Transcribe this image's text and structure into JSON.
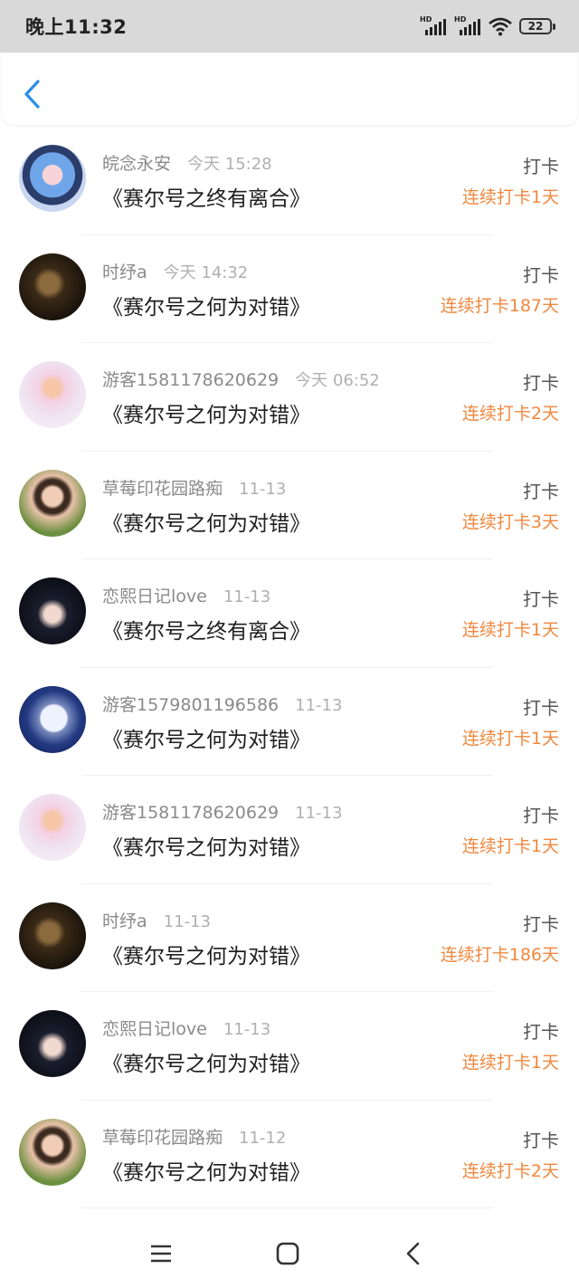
{
  "status": {
    "time": "晚上11:32",
    "signal1": "HD",
    "signal2": "HD",
    "battery": "22"
  },
  "nav": {
    "back_icon": "chevron-left-icon"
  },
  "colors": {
    "accent": "#2a8ee8",
    "streak": "#f0883f"
  },
  "items": [
    {
      "name": "皖念永安",
      "time": "今天 15:28",
      "title": "《赛尔号之终有离合》",
      "tag": "打卡",
      "streak": "连续打卡1天",
      "avatar": "anime-girl-blue"
    },
    {
      "name": "时纾a",
      "time": "今天 14:32",
      "title": "《赛尔号之何为对错》",
      "tag": "打卡",
      "streak": "连续打卡187天",
      "avatar": "dark-photo"
    },
    {
      "name": "游客1581178620629",
      "time": "今天 06:52",
      "title": "《赛尔号之何为对错》",
      "tag": "打卡",
      "streak": "连续打卡2天",
      "avatar": "pink-anime"
    },
    {
      "name": "草莓印花园路痴",
      "time": "11-13",
      "title": "《赛尔号之何为对错》",
      "tag": "打卡",
      "streak": "连续打卡3天",
      "avatar": "girl-photo"
    },
    {
      "name": "恋熙日记love",
      "time": "11-13",
      "title": "《赛尔号之终有离合》",
      "tag": "打卡",
      "streak": "连续打卡1天",
      "avatar": "anime-boy"
    },
    {
      "name": "游客1579801196586",
      "time": "11-13",
      "title": "《赛尔号之何为对错》",
      "tag": "打卡",
      "streak": "连续打卡1天",
      "avatar": "moon"
    },
    {
      "name": "游客1581178620629",
      "time": "11-13",
      "title": "《赛尔号之何为对错》",
      "tag": "打卡",
      "streak": "连续打卡1天",
      "avatar": "pink-anime"
    },
    {
      "name": "时纾a",
      "time": "11-13",
      "title": "《赛尔号之何为对错》",
      "tag": "打卡",
      "streak": "连续打卡186天",
      "avatar": "dark-photo"
    },
    {
      "name": "恋熙日记love",
      "time": "11-13",
      "title": "《赛尔号之何为对错》",
      "tag": "打卡",
      "streak": "连续打卡1天",
      "avatar": "anime-boy"
    },
    {
      "name": "草莓印花园路痴",
      "time": "11-12",
      "title": "《赛尔号之何为对错》",
      "tag": "打卡",
      "streak": "连续打卡2天",
      "avatar": "girl-photo"
    }
  ],
  "system_nav": {
    "menu_icon": "menu-icon",
    "home_icon": "home-square-icon",
    "back_icon": "back-triangle-icon"
  }
}
